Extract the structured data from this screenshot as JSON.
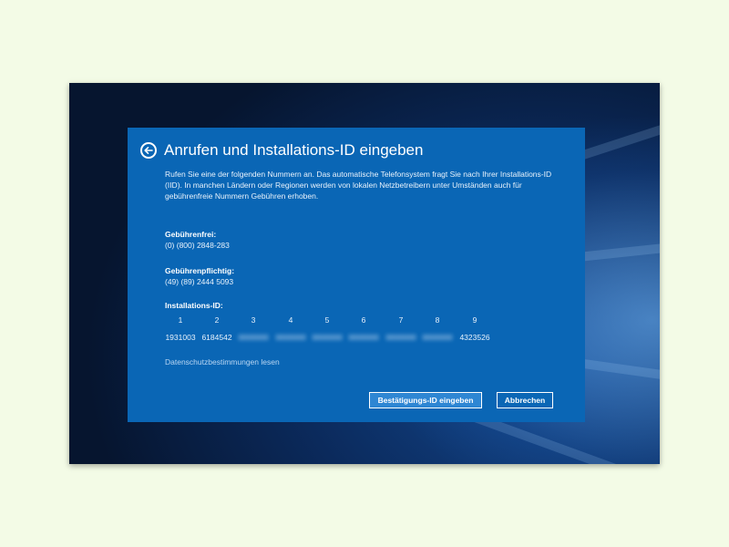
{
  "dialog": {
    "title": "Anrufen und Installations-ID eingeben",
    "description": "Rufen Sie eine der folgenden Nummern an. Das automatische Telefonsystem fragt Sie nach Ihrer Installations-ID (IID). In manchen Ländern oder Regionen werden von lokalen Netzbetreibern unter Umständen auch für gebührenfreie Nummern Gebühren erhoben.",
    "toll_free": {
      "label": "Gebührenfrei:",
      "number": "(0) (800) 2848-283"
    },
    "toll": {
      "label": "Gebührenpflichtig:",
      "number": "(49) (89) 2444 5093"
    },
    "installation_id": {
      "label": "Installations-ID:",
      "groups": [
        {
          "index": "1",
          "value": "1931003",
          "blurred": false
        },
        {
          "index": "2",
          "value": "6184542",
          "blurred": false
        },
        {
          "index": "3",
          "value": "0000000",
          "blurred": true
        },
        {
          "index": "4",
          "value": "0000000",
          "blurred": true
        },
        {
          "index": "5",
          "value": "0000000",
          "blurred": true
        },
        {
          "index": "6",
          "value": "0000000",
          "blurred": true
        },
        {
          "index": "7",
          "value": "0000000",
          "blurred": true
        },
        {
          "index": "8",
          "value": "0000000",
          "blurred": true
        },
        {
          "index": "9",
          "value": "4323526",
          "blurred": false
        }
      ]
    },
    "privacy_link": "Datenschutzbestimmungen lesen",
    "buttons": {
      "confirm": "Bestätigungs-ID eingeben",
      "cancel": "Abbrechen"
    }
  },
  "icons": {
    "back": "back-arrow-icon"
  },
  "colors": {
    "dialog_background": "#0a66b5",
    "primary_button": "#2e86d3",
    "page_background": "#f3fbe6"
  }
}
